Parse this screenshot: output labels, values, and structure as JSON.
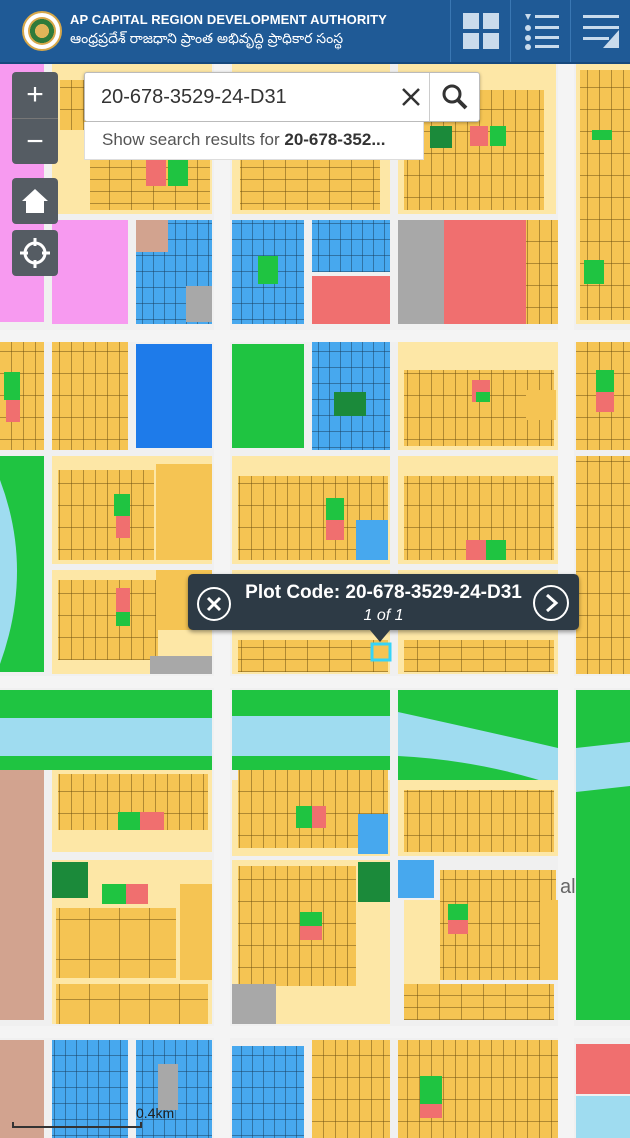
{
  "header": {
    "title_en": "AP CAPITAL REGION DEVELOPMENT AUTHORITY",
    "title_te": "ఆంధ్రప్రదేశ్ రాజధాని ప్రాంత అభివృద్ధి ప్రాధికార సంస్థ",
    "buttons": [
      "grid-icon",
      "list-icon",
      "menu-icon"
    ]
  },
  "map_controls": {
    "zoom_in": "+",
    "zoom_out": "−",
    "home_icon": "home-icon",
    "locate_icon": "locate-icon"
  },
  "search": {
    "value": "20-678-3529-24-D31",
    "suggestion_prefix": "Show search results for ",
    "suggestion_term": "20-678-352..."
  },
  "popup": {
    "title": "Plot Code: 20-678-3529-24-D31",
    "count": "1 of 1"
  },
  "scale": {
    "label": "0.4km"
  },
  "map_labels": {
    "partial_text": "al"
  },
  "colors": {
    "header": "#1f5a96",
    "plot_residential": "#f5c453",
    "plot_light": "#fde7a6",
    "green_space": "#1fc441",
    "water": "#9fdcf0",
    "institutional": "#47a8ee",
    "commercial": "#f06f6f",
    "pink_zone": "#f79af0",
    "grey_zone": "#a8a8a8",
    "brown_zone": "#d2a38f",
    "road": "#f2f2f2",
    "popup": "#2d3a45"
  }
}
